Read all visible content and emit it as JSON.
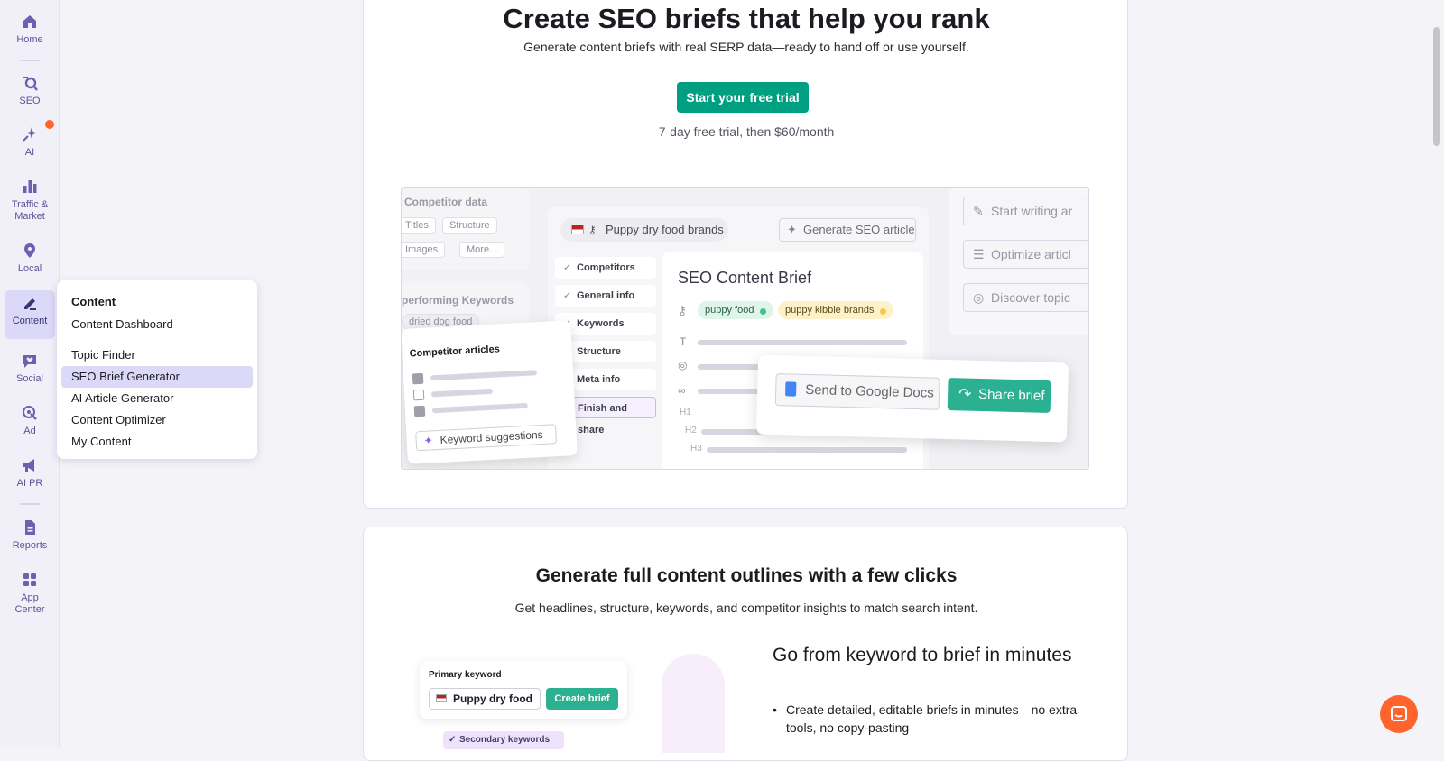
{
  "sidebar": {
    "items": [
      {
        "label": "Home",
        "icon": "home-icon"
      },
      {
        "label": "SEO",
        "icon": "seo-icon"
      },
      {
        "label": "AI",
        "icon": "ai-sparkle-icon"
      },
      {
        "label": "Traffic &",
        "label2": "Market",
        "icon": "bar-chart-icon"
      },
      {
        "label": "Local",
        "icon": "location-pin-icon"
      },
      {
        "label": "Content",
        "icon": "pen-icon"
      },
      {
        "label": "Social",
        "icon": "heart-chat-icon"
      },
      {
        "label": "Ad",
        "icon": "ad-target-icon"
      },
      {
        "label": "AI PR",
        "icon": "megaphone-icon"
      },
      {
        "label": "Reports",
        "icon": "report-doc-icon"
      },
      {
        "label": "App",
        "label2": "Center",
        "icon": "app-grid-icon"
      }
    ]
  },
  "flyout": {
    "title": "Content",
    "items": [
      "Content Dashboard",
      "Topic Finder",
      "SEO Brief Generator",
      "AI Article Generator",
      "Content Optimizer",
      "My Content"
    ],
    "selected": "SEO Brief Generator"
  },
  "hero": {
    "title": "Create SEO briefs that help you rank",
    "subtitle": "Generate content briefs with real SERP data—ready to hand off or use yourself.",
    "cta": "Start your free trial",
    "trial_note": "7-day free trial, then $60/month"
  },
  "illustration": {
    "competitor_data": {
      "title": "Competitor data",
      "chips": [
        "Titles",
        "Structure",
        "Images",
        "More..."
      ]
    },
    "keywords_panel": {
      "title": "performing Keywords",
      "chip": "dried dog food"
    },
    "competitor_articles": {
      "title": "Competitor articles",
      "button": "Keyword suggestions"
    },
    "search_keyword": "Puppy dry food brands",
    "generate_button": "Generate SEO article",
    "steps": [
      "Competitors",
      "General info",
      "Keywords",
      "Structure",
      "Meta info",
      "Finish and share"
    ],
    "brief_title": "SEO Content Brief",
    "keyword_pills": [
      "puppy food",
      "puppy kibble brands"
    ],
    "headings": [
      "H1",
      "H2",
      "H3"
    ],
    "send_button": "Send to Google Docs",
    "share_button": "Share brief",
    "side_actions": [
      "Start writing ar",
      "Optimize articl",
      "Discover topic"
    ]
  },
  "section2": {
    "title": "Generate full content outlines with a few clicks",
    "subtitle": "Get headlines, structure, keywords, and competitor insights to match search intent.",
    "heading": "Go from keyword to brief in minutes",
    "bullet": "Create detailed, editable briefs in minutes—no extra tools, no copy-pasting",
    "mock": {
      "label": "Primary keyword",
      "value": "Puppy dry food",
      "button": "Create brief",
      "secondary": "Secondary keywords"
    }
  },
  "colors": {
    "accent": "#009f81",
    "brand_orange": "#ff642d",
    "nav_text": "#5b5494",
    "selected_bg": "#dcd8f8"
  }
}
